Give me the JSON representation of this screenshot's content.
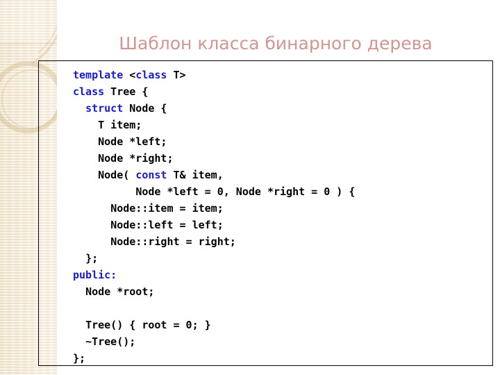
{
  "slide": {
    "title": "Шаблон класса бинарного дерева",
    "title_color": "#d29590",
    "keyword_color": "#1a1acd",
    "text_color": "#000000",
    "sidebar_color": "#f1e6cf",
    "border_color": "#000000"
  },
  "code": {
    "language": "cpp",
    "lines": [
      {
        "indent": 0,
        "segments": [
          {
            "t": "template",
            "k": true
          },
          {
            "t": " <",
            "k": false
          },
          {
            "t": "class",
            "k": true
          },
          {
            "t": " T>",
            "k": false
          }
        ]
      },
      {
        "indent": 0,
        "segments": [
          {
            "t": "class",
            "k": true
          },
          {
            "t": " Tree {",
            "k": false
          }
        ]
      },
      {
        "indent": 2,
        "segments": [
          {
            "t": "struct",
            "k": true
          },
          {
            "t": " Node {",
            "k": false
          }
        ]
      },
      {
        "indent": 4,
        "segments": [
          {
            "t": "T item;",
            "k": false
          }
        ]
      },
      {
        "indent": 4,
        "segments": [
          {
            "t": "Node *left;",
            "k": false
          }
        ]
      },
      {
        "indent": 4,
        "segments": [
          {
            "t": "Node *right;",
            "k": false
          }
        ]
      },
      {
        "indent": 4,
        "segments": [
          {
            "t": "Node( ",
            "k": false
          },
          {
            "t": "const",
            "k": true
          },
          {
            "t": " T& item,",
            "k": false
          }
        ]
      },
      {
        "indent": 10,
        "segments": [
          {
            "t": "Node *left = 0, Node *right = 0 ) {",
            "k": false
          }
        ]
      },
      {
        "indent": 6,
        "segments": [
          {
            "t": "Node::item = item;",
            "k": false
          }
        ]
      },
      {
        "indent": 6,
        "segments": [
          {
            "t": "Node::left = left;",
            "k": false
          }
        ]
      },
      {
        "indent": 6,
        "segments": [
          {
            "t": "Node::right = right;",
            "k": false
          }
        ]
      },
      {
        "indent": 2,
        "segments": [
          {
            "t": "};",
            "k": false
          }
        ]
      },
      {
        "indent": 0,
        "segments": [
          {
            "t": "public:",
            "k": true
          }
        ]
      },
      {
        "indent": 2,
        "segments": [
          {
            "t": "Node *root;",
            "k": false
          }
        ]
      },
      {
        "indent": 0,
        "segments": []
      },
      {
        "indent": 2,
        "segments": [
          {
            "t": "Tree() { root = 0; }",
            "k": false
          }
        ]
      },
      {
        "indent": 2,
        "segments": [
          {
            "t": "~Tree();",
            "k": false
          }
        ]
      },
      {
        "indent": 0,
        "segments": [
          {
            "t": "};",
            "k": false
          }
        ]
      }
    ]
  }
}
